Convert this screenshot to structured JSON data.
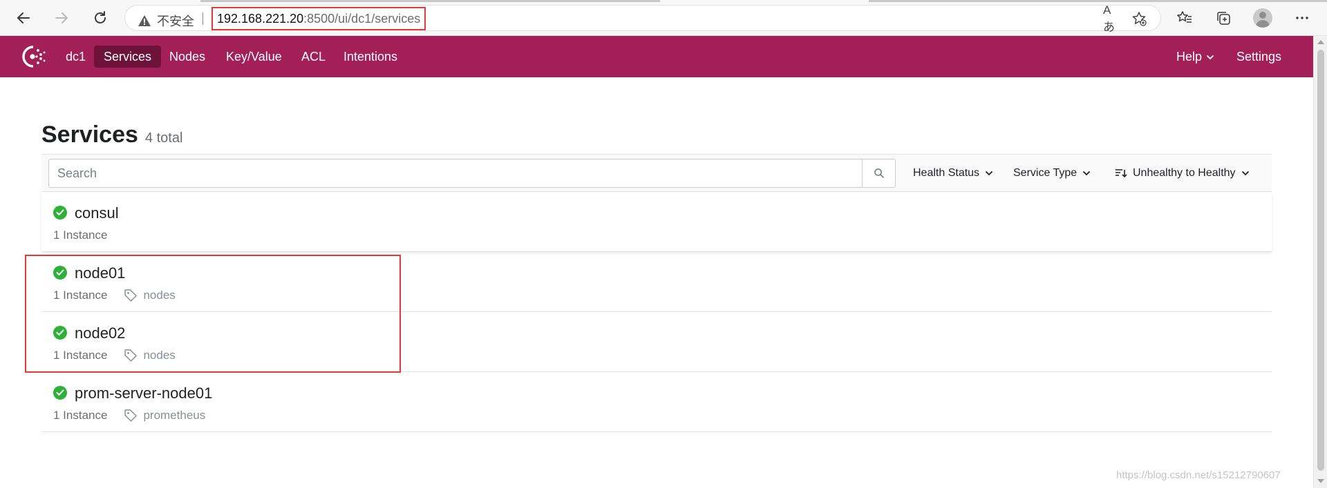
{
  "browser": {
    "security_warning": "不安全",
    "url_host": "192.168.221.20",
    "url_path": ":8500/ui/dc1/services",
    "read_aloud_icon_text": "Aあ"
  },
  "app": {
    "datacenter": "dc1",
    "nav": [
      {
        "label": "Services",
        "active": true
      },
      {
        "label": "Nodes"
      },
      {
        "label": "Key/Value"
      },
      {
        "label": "ACL"
      },
      {
        "label": "Intentions"
      }
    ],
    "help_label": "Help",
    "settings_label": "Settings",
    "brand_color": "#a31f58",
    "active_nav_color": "#6d1339"
  },
  "page": {
    "title": "Services",
    "count": "4 total",
    "search_placeholder": "Search",
    "filters": {
      "health_status": "Health Status",
      "service_type": "Service Type",
      "sort": "Unhealthy to Healthy"
    }
  },
  "services": [
    {
      "name": "consul",
      "instances": "1 Instance",
      "tag": "",
      "status": "passing"
    },
    {
      "name": "node01",
      "instances": "1 Instance",
      "tag": "nodes",
      "status": "passing"
    },
    {
      "name": "node02",
      "instances": "1 Instance",
      "tag": "nodes",
      "status": "passing"
    },
    {
      "name": "prom-server-node01",
      "instances": "1 Instance",
      "tag": "prometheus",
      "status": "passing"
    }
  ],
  "watermark": "https://blog.csdn.net/s15212790607",
  "colors": {
    "passing": "#2eb039",
    "annotation_highlight": "#e53935"
  }
}
